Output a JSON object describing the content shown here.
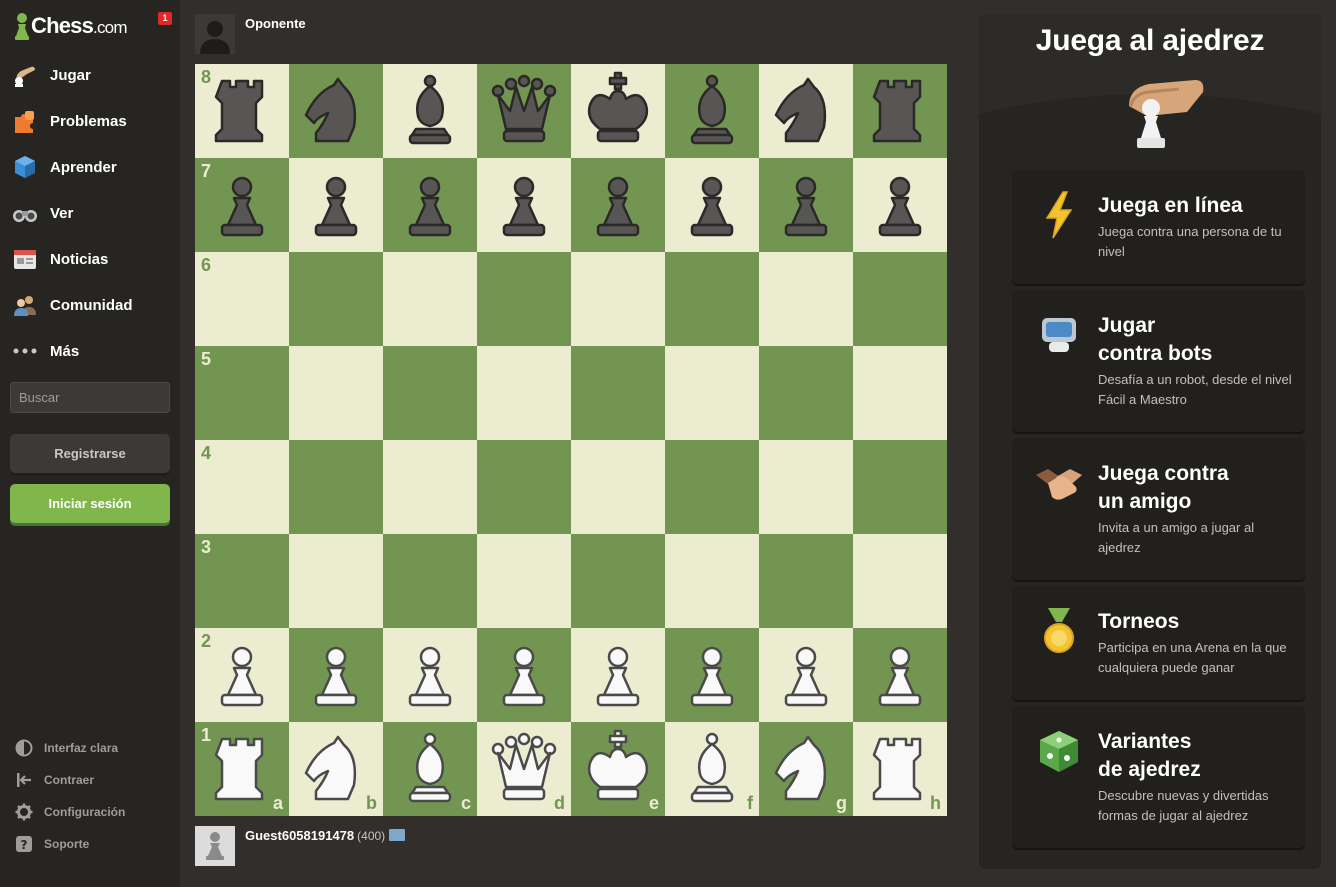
{
  "brand": {
    "logo_main": "Chess",
    "logo_suffix": ".com",
    "notification_count": "1"
  },
  "nav": {
    "items": [
      {
        "label": "Jugar",
        "icon": "play-hand-icon"
      },
      {
        "label": "Problemas",
        "icon": "puzzle-icon"
      },
      {
        "label": "Aprender",
        "icon": "learn-cube-icon"
      },
      {
        "label": "Ver",
        "icon": "binoculars-icon"
      },
      {
        "label": "Noticias",
        "icon": "newspaper-icon"
      },
      {
        "label": "Comunidad",
        "icon": "community-icon"
      },
      {
        "label": "Más",
        "icon": "more-dots-icon"
      }
    ]
  },
  "search": {
    "placeholder": "Buscar"
  },
  "auth": {
    "register_label": "Registrarse",
    "login_label": "Iniciar sesión"
  },
  "footer": {
    "items": [
      {
        "label": "Interfaz clara",
        "icon": "contrast-icon"
      },
      {
        "label": "Contraer",
        "icon": "collapse-icon"
      },
      {
        "label": "Configuración",
        "icon": "gear-icon"
      },
      {
        "label": "Soporte",
        "icon": "help-icon"
      }
    ]
  },
  "players": {
    "top": {
      "name": "Oponente"
    },
    "bottom": {
      "name": "Guest6058191478",
      "rating": "(400)"
    }
  },
  "board": {
    "colors": {
      "light": "#ebecd0",
      "dark": "#739552"
    },
    "ranks": [
      "8",
      "7",
      "6",
      "5",
      "4",
      "3",
      "2",
      "1"
    ],
    "files": [
      "a",
      "b",
      "c",
      "d",
      "e",
      "f",
      "g",
      "h"
    ],
    "position": [
      [
        "br",
        "bn",
        "bb",
        "bq",
        "bk",
        "bb",
        "bn",
        "br"
      ],
      [
        "bp",
        "bp",
        "bp",
        "bp",
        "bp",
        "bp",
        "bp",
        "bp"
      ],
      [
        "",
        "",
        "",
        "",
        "",
        "",
        "",
        ""
      ],
      [
        "",
        "",
        "",
        "",
        "",
        "",
        "",
        ""
      ],
      [
        "",
        "",
        "",
        "",
        "",
        "",
        "",
        ""
      ],
      [
        "",
        "",
        "",
        "",
        "",
        "",
        "",
        ""
      ],
      [
        "wp",
        "wp",
        "wp",
        "wp",
        "wp",
        "wp",
        "wp",
        "wp"
      ],
      [
        "wr",
        "wn",
        "wb",
        "wq",
        "wk",
        "wb",
        "wn",
        "wr"
      ]
    ]
  },
  "panel": {
    "title": "Juega al ajedrez",
    "cards": [
      {
        "title_lines": [
          "Juega en línea"
        ],
        "desc": "Juega contra una persona de tu nivel",
        "icon": "lightning-icon"
      },
      {
        "title_lines": [
          "Jugar",
          "contra bots"
        ],
        "desc": "Desafía a un robot, desde el nivel Fácil a Maestro",
        "icon": "robot-icon"
      },
      {
        "title_lines": [
          "Juega contra",
          "un amigo"
        ],
        "desc": "Invita a un amigo a jugar al ajedrez",
        "icon": "handshake-icon"
      },
      {
        "title_lines": [
          "Torneos"
        ],
        "desc": "Participa en una Arena en la que cualquiera puede ganar",
        "icon": "medal-icon"
      },
      {
        "title_lines": [
          "Variantes",
          "de ajedrez"
        ],
        "desc": "Descubre nuevas y divertidas formas de jugar al ajedrez",
        "icon": "dice-icon"
      }
    ]
  }
}
